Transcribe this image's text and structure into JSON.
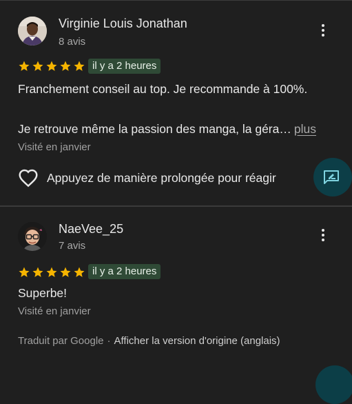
{
  "colors": {
    "background": "#1f1f1f",
    "star": "#f5b400",
    "badge_bg": "#2f4a36",
    "reply_fab": "#0c3e47",
    "reply_icon": "#7fd3e0"
  },
  "reviews": [
    {
      "author": "Virginie Louis Jonathan",
      "review_count": "8 avis",
      "rating": 5,
      "time_ago": "il y a 2 heures",
      "text_line1": "Franchement conseil au top. Je recommande à 100%.",
      "text_line2": "Je retrouve même la passion des manga, la géra…",
      "more_label": "plus",
      "visited": "Visité en janvier",
      "react_label": "Appuyez de manière prolongée pour réagir",
      "icons": {
        "more": "more-vert-icon",
        "react": "heart-outline-icon",
        "reply": "reply-edit-icon"
      }
    },
    {
      "author": "NaeVee_25",
      "review_count": "7 avis",
      "rating": 5,
      "time_ago": "il y a 2 heures",
      "text": "Superbe!",
      "visited": "Visité en janvier",
      "translated_by": "Traduit par Google",
      "separator": "·",
      "show_original": "Afficher la version d'origine (anglais)",
      "icons": {
        "more": "more-vert-icon"
      }
    }
  ]
}
